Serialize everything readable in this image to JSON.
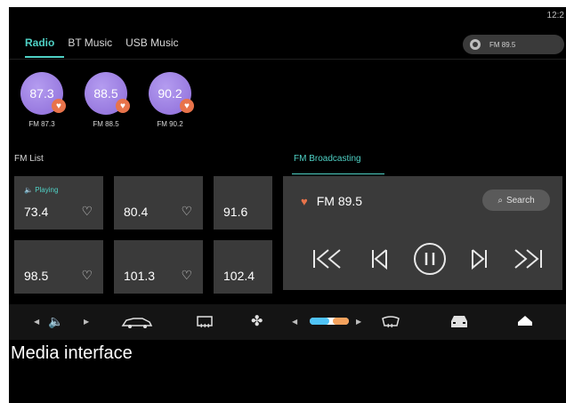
{
  "status": {
    "clock": "12:2"
  },
  "tabs": [
    {
      "label": "Radio"
    },
    {
      "label": "BT Music"
    },
    {
      "label": "USB Music"
    }
  ],
  "now_playing_pill": {
    "label": "FM 89.5"
  },
  "presets": [
    {
      "value": "87.3",
      "label": "FM 87.3"
    },
    {
      "value": "88.5",
      "label": "FM 88.5"
    },
    {
      "value": "90.2",
      "label": "FM 90.2"
    }
  ],
  "sections": {
    "fm_list": "FM List",
    "fm_broadcasting": "FM Broadcasting"
  },
  "stations": [
    {
      "freq": "73.4",
      "playing": "Playing"
    },
    {
      "freq": "80.4"
    },
    {
      "freq": "91.6"
    },
    {
      "freq": "98.5"
    },
    {
      "freq": "101.3"
    },
    {
      "freq": "102.4"
    }
  ],
  "player": {
    "station": "FM 89.5",
    "search_label": "Search"
  },
  "caption": "Media interface",
  "colors": {
    "accent": "#4fd1c5",
    "favorite": "#e8734a",
    "preset": "#9b7fe0",
    "tile": "#3a3a3a"
  }
}
